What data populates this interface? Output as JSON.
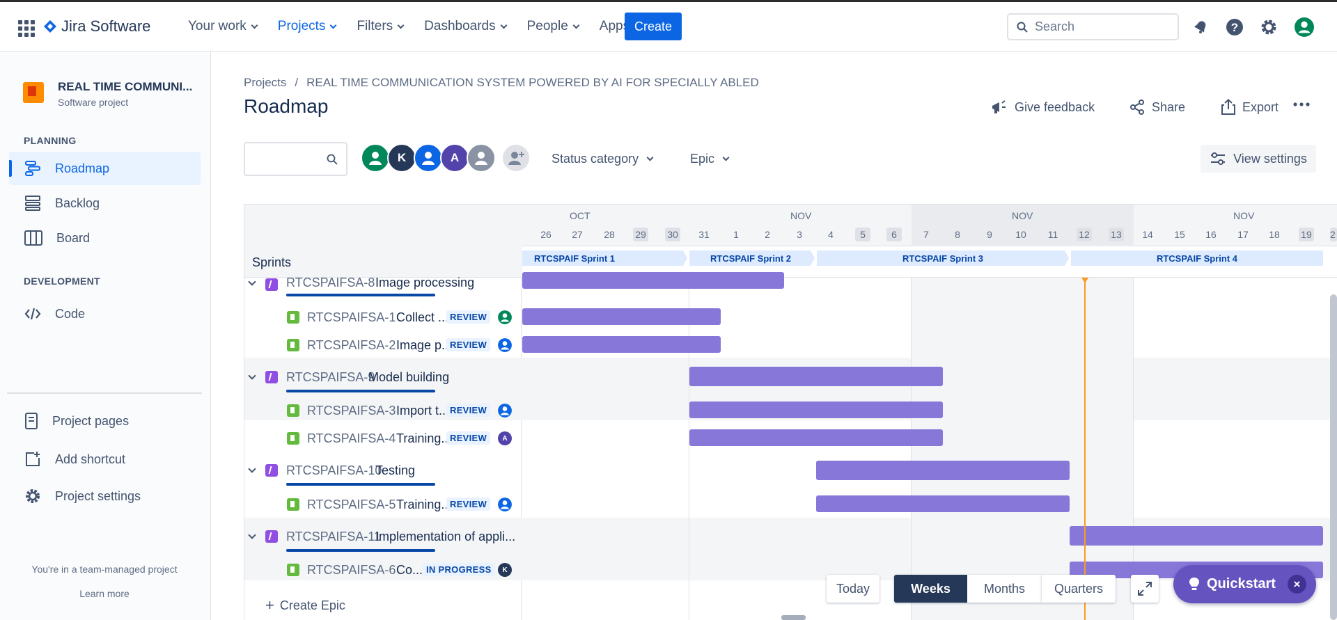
{
  "app": {
    "name": "Jira Software"
  },
  "nav": {
    "items": [
      {
        "label": "Your work"
      },
      {
        "label": "Projects"
      },
      {
        "label": "Filters"
      },
      {
        "label": "Dashboards"
      },
      {
        "label": "People"
      },
      {
        "label": "Apps"
      }
    ],
    "create_label": "Create",
    "search_placeholder": "Search"
  },
  "sidebar": {
    "project_name": "REAL TIME COMMUNI...",
    "project_type": "Software project",
    "planning_title": "PLANNING",
    "development_title": "DEVELOPMENT",
    "items": [
      {
        "label": "Roadmap",
        "icon": "roadmap-icon"
      },
      {
        "label": "Backlog",
        "icon": "backlog-icon"
      },
      {
        "label": "Board",
        "icon": "board-icon"
      },
      {
        "label": "Code",
        "icon": "code-icon"
      },
      {
        "label": "Project pages",
        "icon": "pages-icon"
      },
      {
        "label": "Add shortcut",
        "icon": "add-shortcut-icon"
      },
      {
        "label": "Project settings",
        "icon": "gear-icon"
      }
    ],
    "team_note": "You're in a team-managed project",
    "learn_more": "Learn more"
  },
  "breadcrumb": {
    "projects": "Projects",
    "separator": "/",
    "project": "REAL TIME COMMUNICATION SYSTEM POWERED BY AI FOR SPECIALLY ABLED"
  },
  "page": {
    "title": "Roadmap"
  },
  "header_actions": {
    "feedback": "Give feedback",
    "share": "Share",
    "export": "Export"
  },
  "filters": {
    "avatars": [
      {
        "initial": "",
        "color": "#00875a"
      },
      {
        "initial": "K",
        "color": "#253858"
      },
      {
        "initial": "",
        "color": "#0c66e4"
      },
      {
        "initial": "A",
        "color": "#5243aa"
      },
      {
        "initial": "",
        "color": "#8993a4"
      }
    ],
    "status_category": "Status category",
    "epic": "Epic",
    "view_settings": "View settings"
  },
  "timeline": {
    "months": [
      "OCT",
      "NOV",
      "NOV",
      "NOV"
    ],
    "days": [
      "26",
      "27",
      "28",
      "29",
      "30",
      "31",
      "1",
      "2",
      "3",
      "4",
      "5",
      "6",
      "7",
      "8",
      "9",
      "10",
      "11",
      "12",
      "13",
      "14",
      "15",
      "16",
      "17",
      "18",
      "19",
      "2"
    ],
    "sprints_label": "Sprints",
    "sprints": [
      "RTCSPAIF Sprint 1",
      "RTCSPAIF Sprint 2",
      "RTCSPAIF Sprint 3",
      "RTCSPAIF Sprint 4"
    ]
  },
  "issues": [
    {
      "type": "epic",
      "key": "RTCSPAIFSA-8",
      "summary": "Image processing"
    },
    {
      "type": "story",
      "key": "RTCSPAIFSA-1",
      "summary": "Collect ...",
      "status": "REVIEW",
      "assignee": "#00875a"
    },
    {
      "type": "story",
      "key": "RTCSPAIFSA-2",
      "summary": "Image p...",
      "status": "REVIEW",
      "assignee": "#0c66e4"
    },
    {
      "type": "epic",
      "key": "RTCSPAIFSA-9",
      "summary": "Model building"
    },
    {
      "type": "story",
      "key": "RTCSPAIFSA-3",
      "summary": "Import t...",
      "status": "REVIEW",
      "assignee": "#0c66e4"
    },
    {
      "type": "story",
      "key": "RTCSPAIFSA-4",
      "summary": "Training...",
      "status": "REVIEW",
      "assignee": "#5243aa",
      "assignee_initial": "A"
    },
    {
      "type": "epic",
      "key": "RTCSPAIFSA-10",
      "summary": "Testing"
    },
    {
      "type": "story",
      "key": "RTCSPAIFSA-5",
      "summary": "Training...",
      "status": "REVIEW",
      "assignee": "#0c66e4"
    },
    {
      "type": "epic",
      "key": "RTCSPAIFSA-11",
      "summary": "Implementation of appli..."
    },
    {
      "type": "story",
      "key": "RTCSPAIFSA-6",
      "summary": "Co...",
      "status": "IN PROGRESS",
      "assignee": "#253858",
      "assignee_initial": "K"
    }
  ],
  "create_epic": "Create Epic",
  "zoom": {
    "today": "Today",
    "weeks": "Weeks",
    "months": "Months",
    "quarters": "Quarters"
  },
  "quickstart": {
    "label": "Quickstart",
    "close": "×"
  }
}
